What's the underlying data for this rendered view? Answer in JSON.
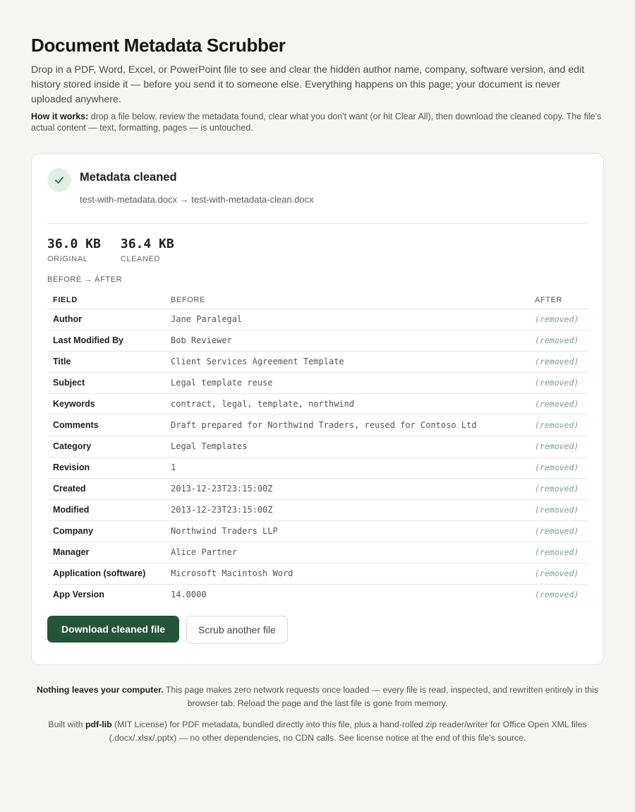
{
  "header": {
    "title": "Document Metadata Scrubber",
    "intro": "Drop in a PDF, Word, Excel, or PowerPoint file to see and clear the hidden author name, company, software version, and edit history stored inside it — before you send it to someone else. Everything happens on this page; your document is never uploaded anywhere.",
    "how_label": "How it works:",
    "how_text": " drop a file below, review the metadata found, clear what you don't want (or hit Clear All), then download the cleaned copy. The file's actual content — text, formatting, pages — is untouched."
  },
  "result": {
    "status_title": "Metadata cleaned",
    "file_line": "test-with-metadata.docx → test-with-metadata-clean.docx",
    "icons": {
      "status": "check-icon"
    },
    "colors": {
      "accent": "#26543a",
      "removed": "#7aa08a",
      "check_bg": "#e3efe6"
    },
    "sizes": [
      {
        "value": "36.0 KB",
        "label": "Original"
      },
      {
        "value": "36.4 KB",
        "label": "Cleaned"
      }
    ],
    "comparison_label": "Before → After",
    "columns": [
      "Field",
      "Before",
      "After"
    ],
    "rows": [
      {
        "field": "Author",
        "before": "Jane Paralegal",
        "after": "(removed)"
      },
      {
        "field": "Last Modified By",
        "before": "Bob Reviewer",
        "after": "(removed)"
      },
      {
        "field": "Title",
        "before": "Client Services Agreement Template",
        "after": "(removed)"
      },
      {
        "field": "Subject",
        "before": "Legal template reuse",
        "after": "(removed)"
      },
      {
        "field": "Keywords",
        "before": "contract, legal, template, northwind",
        "after": "(removed)"
      },
      {
        "field": "Comments",
        "before": "Draft prepared for Northwind Traders, reused for Contoso Ltd",
        "after": "(removed)"
      },
      {
        "field": "Category",
        "before": "Legal Templates",
        "after": "(removed)"
      },
      {
        "field": "Revision",
        "before": "1",
        "after": "(removed)"
      },
      {
        "field": "Created",
        "before": "2013-12-23T23:15:00Z",
        "after": "(removed)"
      },
      {
        "field": "Modified",
        "before": "2013-12-23T23:15:00Z",
        "after": "(removed)"
      },
      {
        "field": "Company",
        "before": "Northwind Traders LLP",
        "after": "(removed)"
      },
      {
        "field": "Manager",
        "before": "Alice Partner",
        "after": "(removed)"
      },
      {
        "field": "Application (software)",
        "before": "Microsoft Macintosh Word",
        "after": "(removed)"
      },
      {
        "field": "App Version",
        "before": "14.0000",
        "after": "(removed)"
      }
    ],
    "download_label": "Download cleaned file",
    "another_label": "Scrub another file"
  },
  "footer": {
    "privacy_bold": "Nothing leaves your computer.",
    "privacy_text": " This page makes zero network requests once loaded — every file is read, inspected, and rewritten entirely in this browser tab. Reload the page and the last file is gone from memory.",
    "built_prefix": "Built with ",
    "built_lib": "pdf-lib",
    "built_text": " (MIT License) for PDF metadata, bundled directly into this file, plus a hand-rolled zip reader/writer for Office Open XML files (.docx/.xlsx/.pptx) — no other dependencies, no CDN calls. See license notice at the end of this file's source."
  }
}
